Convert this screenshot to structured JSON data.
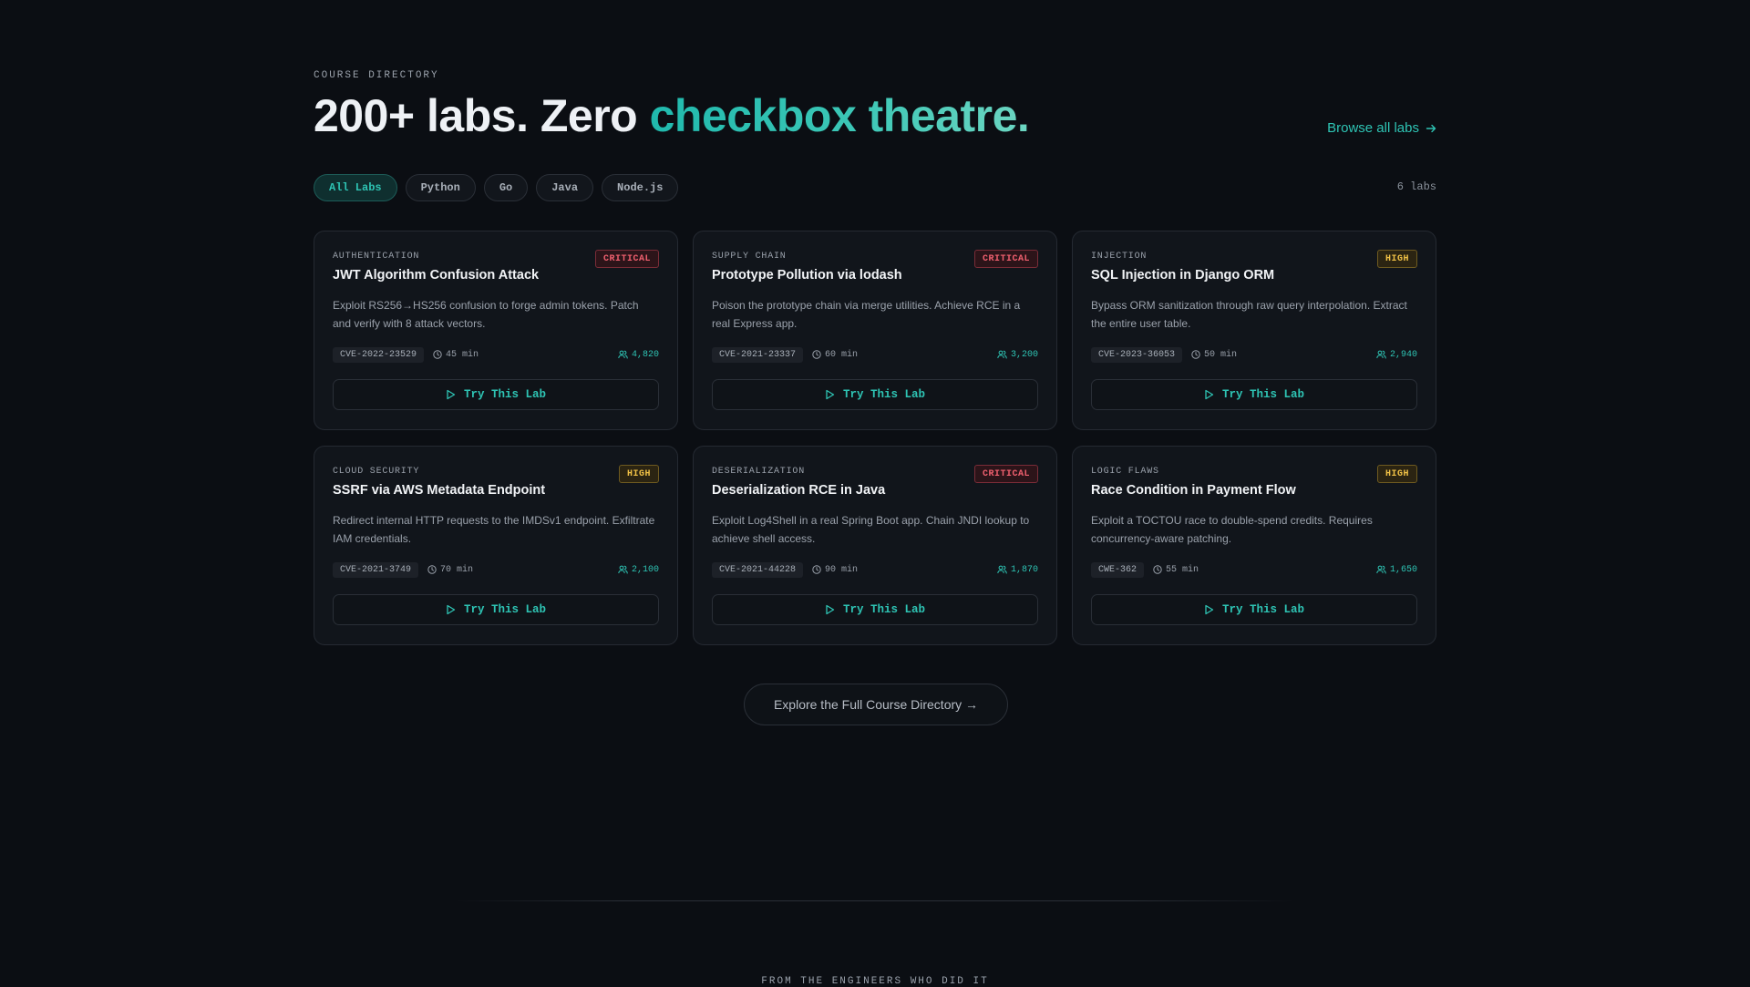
{
  "header": {
    "eyebrow": "COURSE DIRECTORY",
    "title_lead": "200+ labs. Zero ",
    "title_accent": "checkbox theatre.",
    "browse_link": "Browse all labs"
  },
  "filters": {
    "chips": [
      "All Labs",
      "Python",
      "Go",
      "Java",
      "Node.js"
    ],
    "active": "All Labs",
    "count": "6 labs"
  },
  "labs": [
    {
      "category": "AUTHENTICATION",
      "title": "JWT Algorithm Confusion Attack",
      "severity": "CRITICAL",
      "description": "Exploit RS256→HS256 confusion to forge admin tokens. Patch and verify with 8 attack vectors.",
      "cve": "CVE-2022-23529",
      "duration": "45 min",
      "users": "4,820",
      "cta": "Try This Lab"
    },
    {
      "category": "SUPPLY CHAIN",
      "title": "Prototype Pollution via lodash",
      "severity": "CRITICAL",
      "description": "Poison the prototype chain via merge utilities. Achieve RCE in a real Express app.",
      "cve": "CVE-2021-23337",
      "duration": "60 min",
      "users": "3,200",
      "cta": "Try This Lab"
    },
    {
      "category": "INJECTION",
      "title": "SQL Injection in Django ORM",
      "severity": "HIGH",
      "description": "Bypass ORM sanitization through raw query interpolation. Extract the entire user table.",
      "cve": "CVE-2023-36053",
      "duration": "50 min",
      "users": "2,940",
      "cta": "Try This Lab"
    },
    {
      "category": "CLOUD SECURITY",
      "title": "SSRF via AWS Metadata Endpoint",
      "severity": "HIGH",
      "description": "Redirect internal HTTP requests to the IMDSv1 endpoint. Exfiltrate IAM credentials.",
      "cve": "CVE-2021-3749",
      "duration": "70 min",
      "users": "2,100",
      "cta": "Try This Lab"
    },
    {
      "category": "DESERIALIZATION",
      "title": "Deserialization RCE in Java",
      "severity": "CRITICAL",
      "description": "Exploit Log4Shell in a real Spring Boot app. Chain JNDI lookup to achieve shell access.",
      "cve": "CVE-2021-44228",
      "duration": "90 min",
      "users": "1,870",
      "cta": "Try This Lab"
    },
    {
      "category": "LOGIC FLAWS",
      "title": "Race Condition in Payment Flow",
      "severity": "HIGH",
      "description": "Exploit a TOCTOU race to double-spend credits. Requires concurrency-aware patching.",
      "cve": "CWE-362",
      "duration": "55 min",
      "users": "1,650",
      "cta": "Try This Lab"
    }
  ],
  "explore_button": "Explore the Full Course Directory →",
  "footer": {
    "eyebrow": "FROM THE ENGINEERS WHO DID IT"
  },
  "colors": {
    "background": "#0b0e13",
    "accent": "#2ec4b4",
    "critical": "#f0606f",
    "high": "#f0c146"
  },
  "icons": {
    "browse": "arrow-right-icon",
    "duration": "clock-icon",
    "users": "users-icon",
    "cta": "play-icon"
  }
}
